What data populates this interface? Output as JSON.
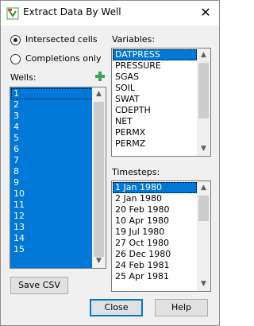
{
  "window": {
    "title": "Extract Data By Well",
    "close_glyph": "✕"
  },
  "options": {
    "intersected_label": "Intersected cells",
    "completions_label": "Completions only",
    "selected": "intersected"
  },
  "wells": {
    "label": "Wells:",
    "add_icon": "plus-icon",
    "items": [
      "1",
      "2",
      "3",
      "4",
      "5",
      "6",
      "7",
      "8",
      "9",
      "10",
      "11",
      "12",
      "13",
      "14",
      "15"
    ]
  },
  "variables": {
    "label": "Variables:",
    "items": [
      "DATPRESS",
      "PRESSURE",
      "SGAS",
      "SOIL",
      "SWAT",
      "CDEPTH",
      "NET",
      "PERMX",
      "PERMZ"
    ],
    "selected": "DATPRESS"
  },
  "timesteps": {
    "label": "Timesteps:",
    "items": [
      "1 Jan 1980",
      "2 Jan 1980",
      "20 Feb 1980",
      "10 Apr 1980",
      "19 Jul 1980",
      "27 Oct 1980",
      "26 Dec 1980",
      "24 Feb 1981",
      "25 Apr 1981"
    ],
    "selected": "1 Jan 1980"
  },
  "buttons": {
    "save_csv": "Save CSV",
    "close": "Close",
    "help": "Help"
  },
  "colors": {
    "selection": "#0078d7",
    "add_icon": "#3aa55a"
  }
}
